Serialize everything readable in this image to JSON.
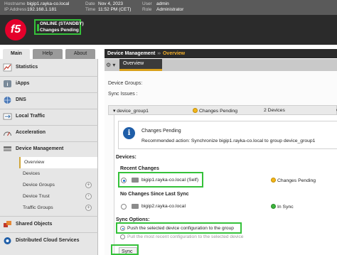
{
  "header": {
    "hostname_label": "Hostname",
    "hostname": "bigip1.rayka-co.local",
    "ip_label": "IP Address",
    "ip": "192.168.1.181",
    "date_label": "Date",
    "date": "Nov 4, 2023",
    "time_label": "Time",
    "time": "11:52 PM (CET)",
    "user_label": "User",
    "user": "admin",
    "role_label": "Role",
    "role": "Administrator",
    "logo_text": "f5",
    "status_line1": "ONLINE (STANDBY)",
    "status_line2": "Changes Pending"
  },
  "nav_tabs": {
    "main": "Main",
    "help": "Help",
    "about": "About"
  },
  "nav": {
    "items": [
      {
        "label": "Statistics",
        "icon": "statistics-icon"
      },
      {
        "label": "iApps",
        "icon": "iapps-icon"
      },
      {
        "label": "DNS",
        "icon": "dns-icon"
      },
      {
        "label": "Local Traffic",
        "icon": "local-traffic-icon"
      },
      {
        "label": "Acceleration",
        "icon": "acceleration-icon"
      },
      {
        "label": "Device Management",
        "icon": "device-management-icon"
      },
      {
        "label": "Shared Objects",
        "icon": "shared-objects-icon"
      },
      {
        "label": "Distributed Cloud Services",
        "icon": "cloud-services-icon"
      }
    ],
    "sub_items": [
      "Overview",
      "Devices",
      "Device Groups",
      "Device Trust",
      "Traffic Groups"
    ]
  },
  "breadcrumb": {
    "section": "Device Management",
    "separator": "››",
    "current": "Overview"
  },
  "toolbar": {
    "gear": "⚙ ▾",
    "tab": "Overview"
  },
  "main": {
    "device_groups_label": "Device Groups:",
    "sync_issues_label": "Sync Issues :",
    "group": {
      "name": "▾ device_group1",
      "status": "Changes Pending",
      "devices": "2 Devices",
      "extra": "C"
    },
    "info": {
      "title": "Changes Pending",
      "recommendation": "Recommended action: Synchronize bigip1.rayka-co.local to group device_group1"
    },
    "devices_label": "Devices:",
    "recent_changes_label": "Recent Changes",
    "recent_device": {
      "name": "bigip1.rayka-co.local (Self)",
      "status": "Changes Pending"
    },
    "no_changes_label": "No Changes Since Last Sync",
    "other_device": {
      "name": "bigip2.rayka-co.local",
      "status": "In Sync"
    },
    "sync_options_label": "Sync Options:",
    "option_push": "Push the selected device configuration to the group",
    "option_pull": "Pull the most recent configuration to the selected device",
    "sync_button": "Sync"
  },
  "colors": {
    "highlight": "#35c13a",
    "logo": "#e4002b",
    "breadcrumb_current": "#f3b02c",
    "pending": "#f2b51a",
    "in_sync": "#3cb43c"
  }
}
